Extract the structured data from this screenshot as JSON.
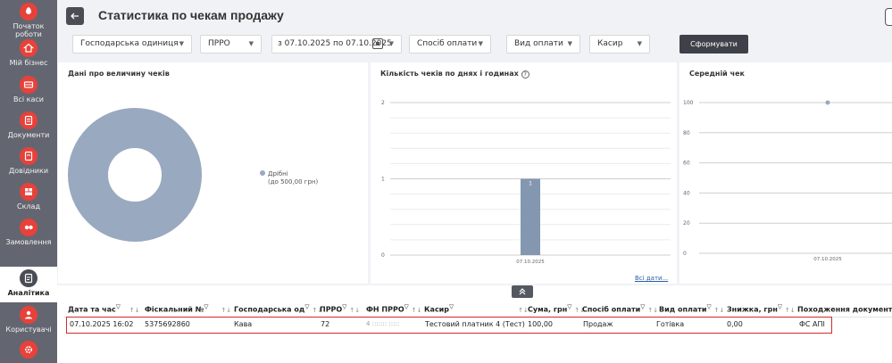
{
  "sidebar": {
    "items": [
      {
        "label": "Початок роботи",
        "icon": "rocket-icon"
      },
      {
        "label": "Мій бізнес",
        "icon": "home-icon"
      },
      {
        "label": "Всі каси",
        "icon": "cash-register-icon"
      },
      {
        "label": "Документи",
        "icon": "document-icon"
      },
      {
        "label": "Довідники",
        "icon": "directory-icon"
      },
      {
        "label": "Склад",
        "icon": "warehouse-icon"
      },
      {
        "label": "Замовлення",
        "icon": "orders-icon"
      },
      {
        "label": "Аналітика",
        "icon": "analytics-icon"
      },
      {
        "label": "Користувачі",
        "icon": "users-icon"
      },
      {
        "label": "",
        "icon": "settings-icon"
      }
    ],
    "active": "Аналітика"
  },
  "header": {
    "title": "Статистика по чекам продажу",
    "filters": {
      "business_unit": "Господарська одиниця",
      "prro": "ПРРО",
      "date_range": "з 07.10.2025 по 07.10.2025",
      "payment_method": "Спосіб оплати",
      "payment_type": "Вид оплати",
      "cashier": "Касир"
    },
    "submit_label": "Сформувати"
  },
  "panels": {
    "receipt_size": {
      "title": "Дані про величину чеків",
      "legend_line1": "Дрібні",
      "legend_line2": "(до 500,00 грн)"
    },
    "count_by_day": {
      "title": "Кількість чеків по днях і годинах",
      "all_dates_link": "Всі дати..."
    },
    "average_receipt": {
      "title": "Середній чек"
    }
  },
  "chart_data": [
    {
      "type": "pie",
      "title": "Дані про величину чеків",
      "slices": [
        {
          "label": "Дрібні (до 500,00 грн)",
          "value": 100,
          "color": "#99a9c0"
        }
      ],
      "donut": true
    },
    {
      "type": "bar",
      "title": "Кількість чеків по днях і годинах",
      "categories": [
        "07.10.2025"
      ],
      "values": [
        1
      ],
      "data_labels": [
        "1"
      ],
      "yticks": [
        "2",
        "1",
        "0"
      ],
      "ylim": [
        0,
        2
      ],
      "color": "#8497b0"
    },
    {
      "type": "line",
      "title": "Середній чек",
      "x": [
        "07.10.2025"
      ],
      "y": [
        100
      ],
      "yticks": [
        "100",
        "80",
        "60",
        "40",
        "20",
        "0"
      ],
      "ylim": [
        0,
        100
      ],
      "color": "#99a9c0"
    }
  ],
  "table": {
    "columns": [
      "Дата та час",
      "Фіскальний №",
      "Господарська од",
      "ПРРО",
      "ФН ПРРО",
      "Касир",
      "Сума, грн",
      "Спосіб оплати",
      "Вид оплати",
      "Знижка, грн",
      "Походження документа"
    ],
    "rows": [
      {
        "datetime": "07.10.2025 16:02",
        "fiscal_no": "5375692860",
        "business_unit": "Кава",
        "prro": "72",
        "fn_prro": "4 ::::::: :::::",
        "cashier": "Тестовий платник 4 (Тест)",
        "sum": "100,00",
        "payment_method": "Продаж",
        "payment_type": "Готівка",
        "discount": "0,00",
        "origin": "ФС АПІ"
      }
    ]
  },
  "colors": {
    "sidebar_bg": "#636670",
    "sidebar_icon": "#e8413a",
    "highlight_border": "#d42a2a",
    "chart_fill": "#99a9c0",
    "bar_fill": "#8497b0",
    "primary_button": "#3e414a"
  }
}
